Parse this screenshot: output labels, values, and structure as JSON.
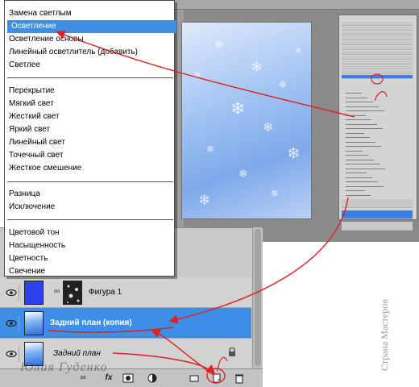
{
  "menu": {
    "group1": [
      "Замена светлым",
      "Осветление",
      "Осветление основы",
      "Линейный осветлитель (добавить)",
      "Светлее"
    ],
    "selected_index": 1,
    "group2": [
      "Перекрытие",
      "Мягкий свет",
      "Жесткий свет",
      "Яркий свет",
      "Линейный свет",
      "Точечный свет",
      "Жесткое смешение"
    ],
    "group3": [
      "Разница",
      "Исключение"
    ],
    "group4": [
      "Цветовой тон",
      "Насыщенность",
      "Цветность",
      "Свечение"
    ]
  },
  "layers": [
    {
      "name": "Фигура 1",
      "selected": false
    },
    {
      "name": "Задний план (копия)",
      "selected": true
    },
    {
      "name": "Задний план",
      "selected": false
    }
  ],
  "toolbar": {
    "icons": [
      "link-icon",
      "fx-icon",
      "mask-icon",
      "adjustment-icon",
      "folder-icon",
      "new-layer-icon",
      "trash-icon"
    ],
    "fx_label": "fx"
  },
  "watermarks": {
    "author": "Юлия Гуденко",
    "site": "Страна Мастеров"
  },
  "colors": {
    "selection": "#3e8fe0",
    "annotation": "#e02020"
  }
}
